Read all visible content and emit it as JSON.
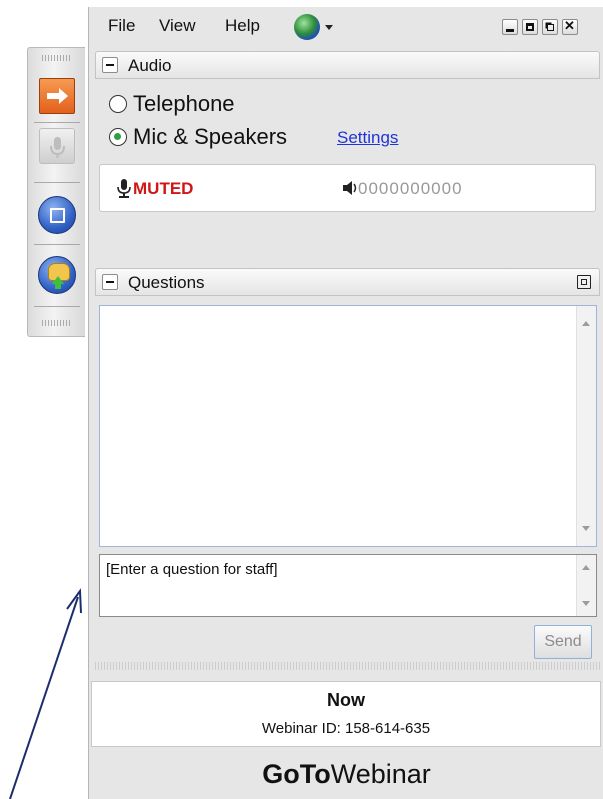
{
  "menu": {
    "file": "File",
    "view": "View",
    "help": "Help"
  },
  "audio": {
    "title": "Audio",
    "options": [
      "Telephone",
      "Mic & Speakers"
    ],
    "selected_option": "Mic & Speakers",
    "settings_link": "Settings",
    "status": "MUTED",
    "level_value": "0000000000"
  },
  "questions": {
    "title": "Questions",
    "input_placeholder": "[Enter a question for staff]",
    "send_label": "Send"
  },
  "footer": {
    "session": "Now",
    "webinar_id": "Webinar ID: 158-614-635",
    "brand_bold": "GoTo",
    "brand_rest": "Webinar"
  },
  "colors": {
    "muted": "#d01616",
    "link": "#1f34d6",
    "annotation_arrow": "#1a2e6e"
  },
  "icons": {
    "toolbar": [
      "arrow-icon",
      "microphone-icon",
      "screen-icon",
      "raise-hand-icon"
    ],
    "menubar": [
      "globe-icon"
    ],
    "audio": [
      "microphone-icon",
      "speaker-icon"
    ]
  }
}
